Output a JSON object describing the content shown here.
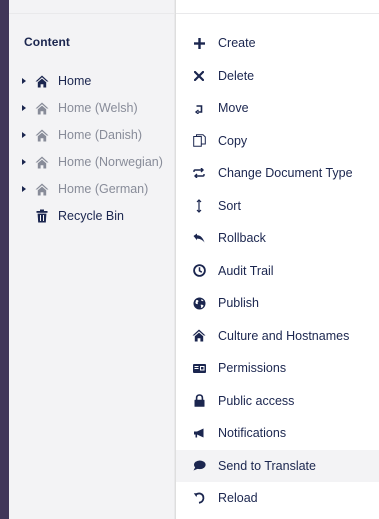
{
  "tree": {
    "title": "Content",
    "items": [
      {
        "label": "Home",
        "icon": "home-icon",
        "muted": false,
        "expandable": true
      },
      {
        "label": "Home (Welsh)",
        "icon": "home-icon",
        "muted": true,
        "expandable": true
      },
      {
        "label": "Home (Danish)",
        "icon": "home-icon",
        "muted": true,
        "expandable": true
      },
      {
        "label": "Home (Norwegian)",
        "icon": "home-icon",
        "muted": true,
        "expandable": true
      },
      {
        "label": "Home (German)",
        "icon": "home-icon",
        "muted": true,
        "expandable": true
      },
      {
        "label": "Recycle Bin",
        "icon": "trash-icon",
        "muted": false,
        "expandable": false
      }
    ]
  },
  "menu": {
    "items": [
      {
        "label": "Create",
        "icon": "plus-icon"
      },
      {
        "label": "Delete",
        "icon": "close-icon"
      },
      {
        "label": "Move",
        "icon": "move-icon"
      },
      {
        "label": "Copy",
        "icon": "copy-icon"
      },
      {
        "label": "Change Document Type",
        "icon": "swap-icon"
      },
      {
        "label": "Sort",
        "icon": "sort-icon"
      },
      {
        "label": "Rollback",
        "icon": "rollback-icon"
      },
      {
        "label": "Audit Trail",
        "icon": "clock-icon"
      },
      {
        "label": "Publish",
        "icon": "globe-icon"
      },
      {
        "label": "Culture and Hostnames",
        "icon": "home-icon"
      },
      {
        "label": "Permissions",
        "icon": "permissions-icon"
      },
      {
        "label": "Public access",
        "icon": "lock-icon"
      },
      {
        "label": "Notifications",
        "icon": "megaphone-icon"
      },
      {
        "label": "Send to Translate",
        "icon": "chat-bubble-icon"
      },
      {
        "label": "Reload",
        "icon": "reload-icon"
      }
    ]
  },
  "colors": {
    "sidebar_strip": "#413659",
    "tree_background": "#f3f3f5",
    "text": "#1b264f",
    "muted_text": "#888c99",
    "highlight": "#f3f3f5"
  }
}
